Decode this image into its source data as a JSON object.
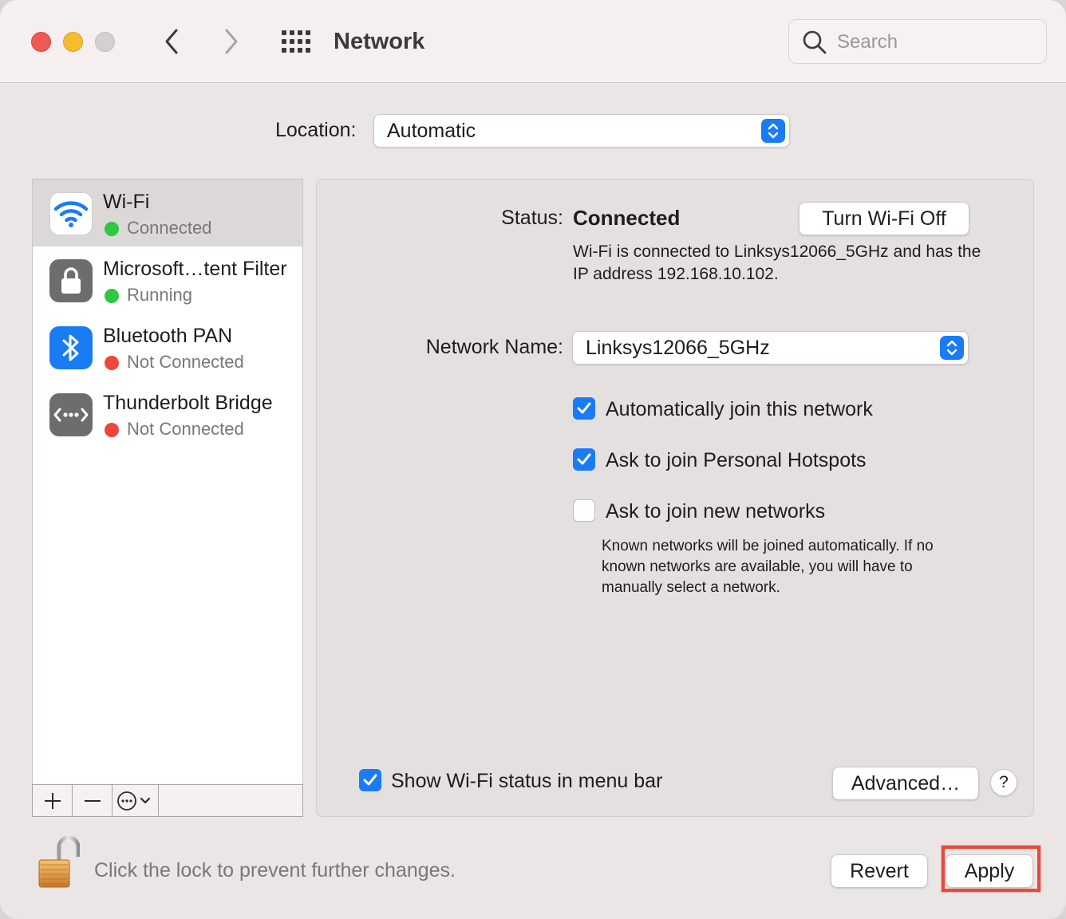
{
  "window": {
    "title": "Network",
    "search_placeholder": "Search"
  },
  "location": {
    "label": "Location:",
    "value": "Automatic"
  },
  "services": [
    {
      "name": "Wi-Fi",
      "status": "Connected",
      "status_color": "#2fc840",
      "icon": "wifi-icon",
      "selected": true
    },
    {
      "name": "Microsoft…tent Filter",
      "status": "Running",
      "status_color": "#2fc840",
      "icon": "lock-icon"
    },
    {
      "name": "Bluetooth PAN",
      "status": "Not Connected",
      "status_color": "#f0453a",
      "icon": "bluetooth-icon"
    },
    {
      "name": "Thunderbolt Bridge",
      "status": "Not Connected",
      "status_color": "#f0453a",
      "icon": "thunderbolt-bridge-icon"
    }
  ],
  "sidebar_tools": {
    "add": "+",
    "remove": "−"
  },
  "detail": {
    "status_label": "Status:",
    "status_value": "Connected",
    "toggle_button": "Turn Wi-Fi Off",
    "description": "Wi-Fi is connected to Linksys12066_5GHz and has the IP address 192.168.10.102.",
    "network_name_label": "Network Name:",
    "network_name_value": "Linksys12066_5GHz",
    "options": [
      {
        "label": "Automatically join this network",
        "checked": true
      },
      {
        "label": "Ask to join Personal Hotspots",
        "checked": true
      },
      {
        "label": "Ask to join new networks",
        "checked": false
      }
    ],
    "note": "Known networks will be joined automatically. If no known networks are available, you will have to manually select a network.",
    "show_status_label": "Show Wi-Fi status in menu bar",
    "show_status_checked": true,
    "advanced_button": "Advanced…",
    "help_button": "?"
  },
  "footer": {
    "lock_text": "Click the lock to prevent further changes.",
    "revert_button": "Revert",
    "apply_button": "Apply"
  },
  "colors": {
    "accent": "#1a7cf5",
    "highlight": "#e64a3c"
  }
}
